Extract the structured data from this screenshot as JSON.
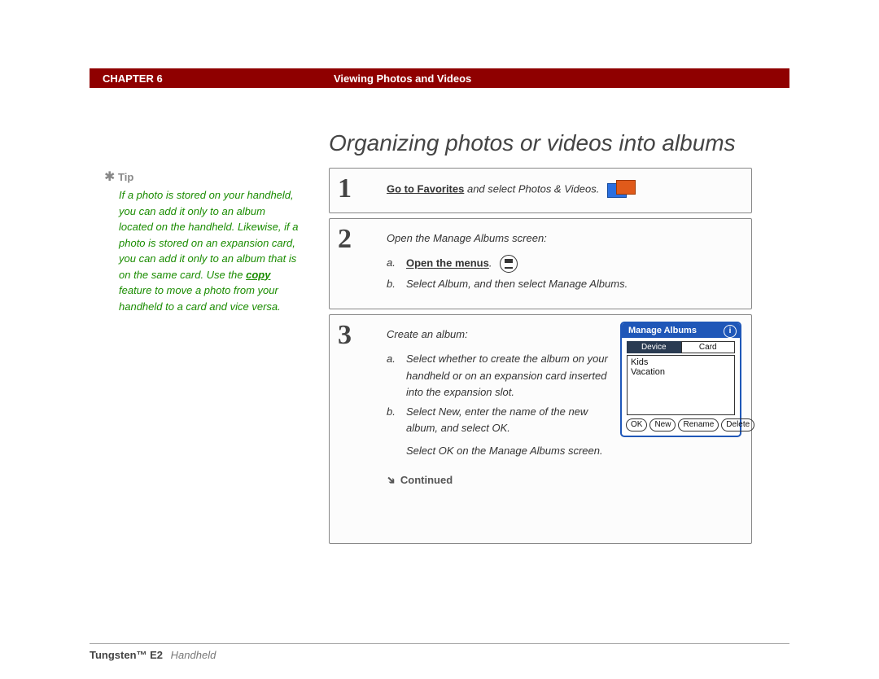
{
  "header": {
    "chapter": "CHAPTER 6",
    "breadcrumb": "Viewing Photos and Videos"
  },
  "title": "Organizing photos or videos into albums",
  "tip": {
    "label": "Tip",
    "text_pre": "If a photo is stored on your handheld, you can add it only to an album located on the handheld. Likewise, if a photo is stored on an expansion card, you can add it only to an album that is on the same card. Use the ",
    "copy_word": "copy",
    "text_post": " feature to move a photo from your handheld to a card and vice versa."
  },
  "steps": [
    {
      "num": "1",
      "line_pre_bold": "Go to Favorites",
      "line_post": " and select Photos & Videos.",
      "icon": "media-icon"
    },
    {
      "num": "2",
      "intro": "Open the Manage Albums screen:",
      "a": {
        "bold": "Open the menus",
        "rest": ".",
        "icon": "menus-icon"
      },
      "b_text": "Select Album, and then select Manage Albums."
    },
    {
      "num": "3",
      "intro": "Create an album:",
      "a_text": "Select whether to create the album on your handheld or on an expansion card inserted into the expansion slot.",
      "b_text": "Select New, enter the name of the new album, and select OK.",
      "tail": "Select OK on the Manage Albums screen.",
      "continued": "Continued"
    }
  ],
  "dialog": {
    "title": "Manage Albums",
    "tabs": [
      "Device",
      "Card"
    ],
    "items": [
      "Kids",
      "Vacation"
    ],
    "buttons": [
      "OK",
      "New",
      "Rename",
      "Delete"
    ]
  },
  "footer": {
    "product": "Tungsten™ E2",
    "sub": "Handheld"
  }
}
